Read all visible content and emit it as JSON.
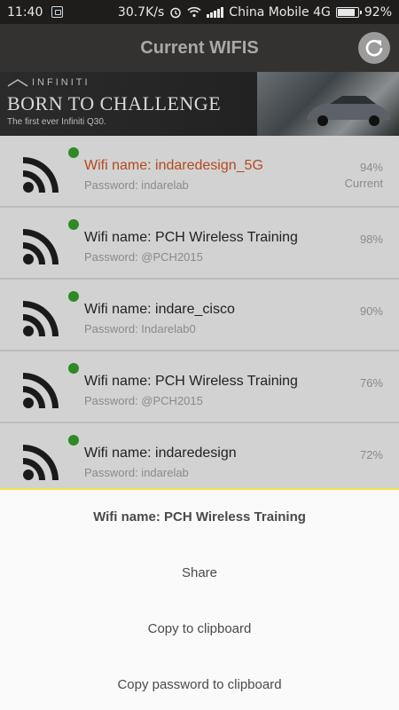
{
  "status_bar": {
    "time": "11:40",
    "speed": "30.7K/s",
    "carrier": "China Mobile 4G",
    "battery": "92%",
    "battery_level": 0.92
  },
  "app_bar": {
    "title": "Current WIFIS"
  },
  "ad": {
    "brand": "INFINITI",
    "headline": "BORN TO CHALLENGE",
    "subline": "The first ever Infiniti Q30."
  },
  "wifi_list": [
    {
      "name": "Wifi name: indaredesign_5G",
      "password": "Password: indarelab",
      "signal": "94%",
      "tag": "Current"
    },
    {
      "name": "Wifi name: PCH Wireless Training",
      "password": "Password: @PCH2015",
      "signal": "98%",
      "tag": ""
    },
    {
      "name": "Wifi name: indare_cisco",
      "password": "Password: Indarelab0",
      "signal": "90%",
      "tag": ""
    },
    {
      "name": "Wifi name: PCH Wireless Training",
      "password": "Password: @PCH2015",
      "signal": "76%",
      "tag": ""
    },
    {
      "name": "Wifi name: indaredesign",
      "password": "Password: indarelab",
      "signal": "72%",
      "tag": ""
    }
  ],
  "sheet": {
    "title": "Wifi name: PCH Wireless Training",
    "share": "Share",
    "copy": "Copy to clipboard",
    "copy_password": "Copy password to clipboard"
  },
  "colors": {
    "current_name": "#b24a1e",
    "status_dot": "#2e8a26",
    "sheet_accent": "#f1e34a"
  }
}
